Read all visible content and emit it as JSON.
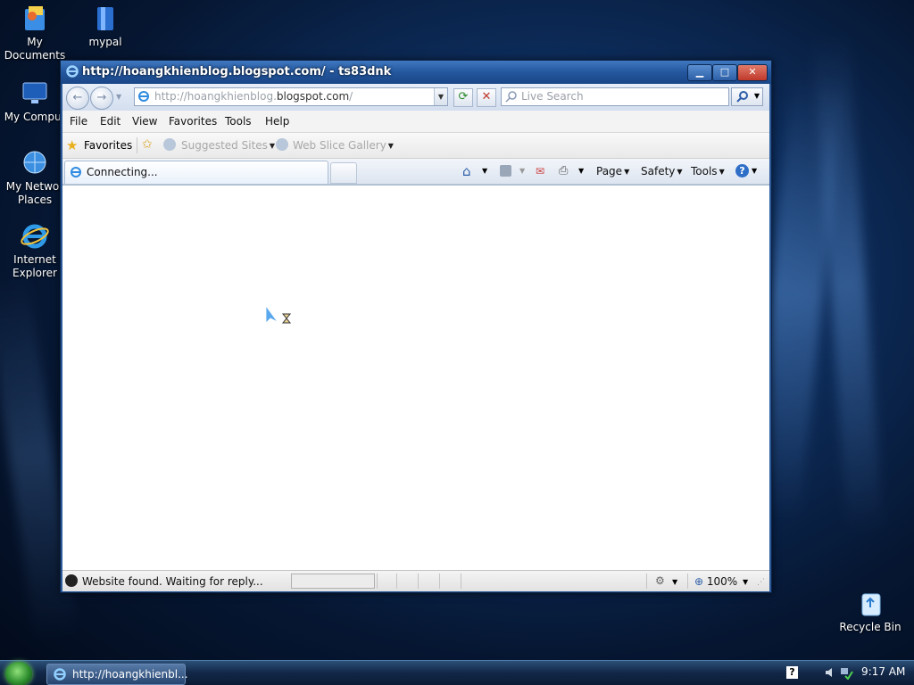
{
  "desktop": {
    "icons": [
      {
        "label": "My\nDocuments"
      },
      {
        "label": "mypal"
      },
      {
        "label": "My Comput"
      },
      {
        "label": "My Networ\nPlaces"
      },
      {
        "label": "Internet\nExplorer"
      },
      {
        "label": "Recycle Bin"
      }
    ]
  },
  "window": {
    "title": "http://hoangkhienblog.blogspot.com/ - ts83dnk",
    "min_symbol": "▁",
    "max_symbol": "□",
    "close_symbol": "✕"
  },
  "address": {
    "url_prefix": "http://hoangkhienblog.",
    "url_domain": "blogspot.com",
    "url_suffix": "/",
    "back_symbol": "←",
    "forward_symbol": "→",
    "refresh_symbol": "⟳",
    "stop_symbol": "✕"
  },
  "search": {
    "placeholder": "Live Search"
  },
  "menu": [
    "File",
    "Edit",
    "View",
    "Favorites",
    "Tools",
    "Help"
  ],
  "favorites_bar": {
    "favorites_label": "Favorites",
    "suggested_sites": "Suggested Sites",
    "web_slice_gallery": "Web Slice Gallery"
  },
  "tab": {
    "label": "Connecting..."
  },
  "command_bar": {
    "page": "Page",
    "safety": "Safety",
    "tools": "Tools"
  },
  "status": {
    "text": "Website found. Waiting for reply...",
    "zoom": "100%",
    "progress": 0
  },
  "taskbar": {
    "task_label": "http://hoangkhienbl...",
    "clock": "9:17 AM",
    "help": "?"
  },
  "colors": {
    "accent": "#2a5a9a",
    "close_red": "#c0392b"
  }
}
